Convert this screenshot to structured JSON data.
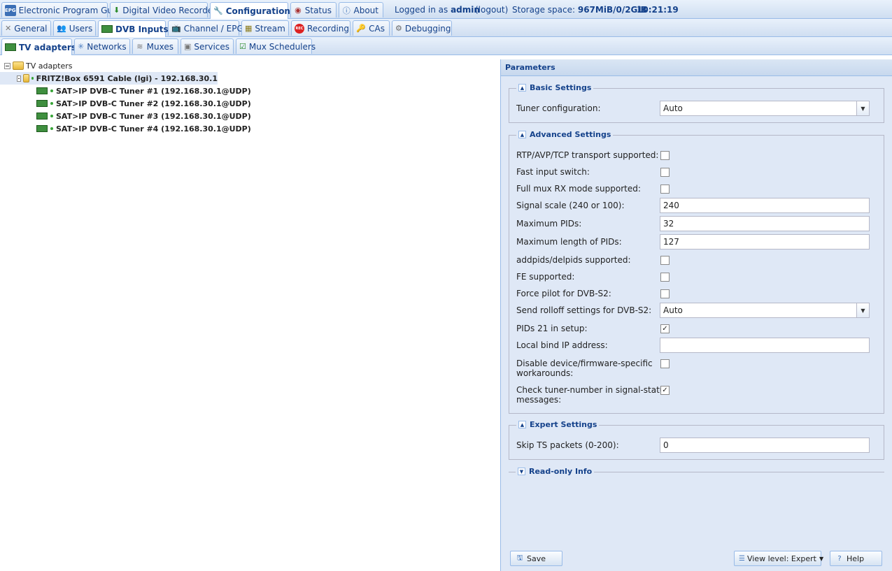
{
  "top_tabs": [
    {
      "label": "Electronic Program Guide",
      "icon": "epg-icon"
    },
    {
      "label": "Digital Video Recorder",
      "icon": "download-icon"
    },
    {
      "label": "Configuration",
      "icon": "wrench-icon"
    },
    {
      "label": "Status",
      "icon": "eye-icon"
    },
    {
      "label": "About",
      "icon": "info-icon"
    }
  ],
  "status": {
    "logged_in_prefix": "Logged in as",
    "user": "admin",
    "logout": "(logout)",
    "storage_prefix": "Storage space:",
    "storage_value": "967MiB/0/2GiB",
    "time": "10:21:19"
  },
  "config_tabs": [
    {
      "label": "General"
    },
    {
      "label": "Users"
    },
    {
      "label": "DVB Inputs"
    },
    {
      "label": "Channel / EPG"
    },
    {
      "label": "Stream"
    },
    {
      "label": "Recording"
    },
    {
      "label": "CAs"
    },
    {
      "label": "Debugging"
    }
  ],
  "dvb_tabs": [
    {
      "label": "TV adapters"
    },
    {
      "label": "Networks"
    },
    {
      "label": "Muxes"
    },
    {
      "label": "Services"
    },
    {
      "label": "Mux Schedulers"
    }
  ],
  "tree": {
    "root": "TV adapters",
    "device": "FRITZ!Box 6591 Cable (lgi) - 192.168.30.1",
    "tuners": [
      "SAT>IP DVB-C Tuner #1 (192.168.30.1@UDP)",
      "SAT>IP DVB-C Tuner #2 (192.168.30.1@UDP)",
      "SAT>IP DVB-C Tuner #3 (192.168.30.1@UDP)",
      "SAT>IP DVB-C Tuner #4 (192.168.30.1@UDP)"
    ]
  },
  "panel": {
    "title": "Parameters",
    "basic": {
      "legend": "Basic Settings",
      "tuner_config_label": "Tuner configuration:",
      "tuner_config_value": "Auto"
    },
    "advanced": {
      "legend": "Advanced Settings",
      "rtp_label": "RTP/AVP/TCP transport supported:",
      "rtp_checked": false,
      "fast_label": "Fast input switch:",
      "fast_checked": false,
      "fullmux_label": "Full mux RX mode supported:",
      "fullmux_checked": false,
      "signal_label": "Signal scale (240 or 100):",
      "signal_value": "240",
      "maxpids_label": "Maximum PIDs:",
      "maxpids_value": "32",
      "maxlen_label": "Maximum length of PIDs:",
      "maxlen_value": "127",
      "addpids_label": "addpids/delpids supported:",
      "addpids_checked": false,
      "fe_label": "FE supported:",
      "fe_checked": false,
      "pilot_label": "Force pilot for DVB-S2:",
      "pilot_checked": false,
      "rolloff_label": "Send rolloff settings for DVB-S2:",
      "rolloff_value": "Auto",
      "pids21_label": "PIDs 21 in setup:",
      "pids21_checked": true,
      "bind_label": "Local bind IP address:",
      "bind_value": "",
      "disable_label_1": "Disable device/firmware-specific",
      "disable_label_2": "workarounds:",
      "disable_checked": false,
      "check_label_1": "Check tuner-number in signal-status",
      "check_label_2": "messages:",
      "check_checked": true
    },
    "expert": {
      "legend": "Expert Settings",
      "skip_label": "Skip TS packets (0-200):",
      "skip_value": "0"
    },
    "readonly": {
      "legend": "Read-only Info"
    },
    "buttons": {
      "save": "Save",
      "view_level": "View level: Expert",
      "help": "Help"
    }
  },
  "colors": {
    "accent": "#15428b",
    "panel_bg": "#dfe8f6",
    "border": "#99bbe8",
    "selected": "#dfe8f6"
  }
}
